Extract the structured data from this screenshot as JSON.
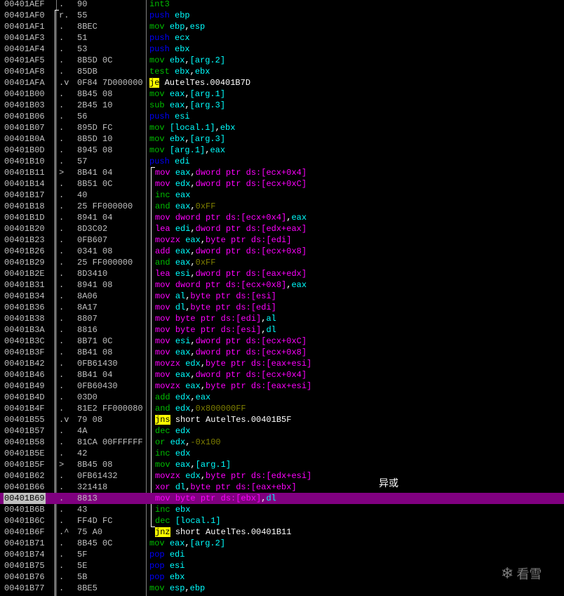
{
  "colors": {
    "background": "#000000",
    "selection": "#800080",
    "address": "#c0c0c0",
    "jump_highlight": "#ffff00",
    "register": "#00ffff",
    "memory": "#ff00ff",
    "constant": "#808000"
  },
  "rows": [
    {
      "addr": "00401AEF",
      "mark": ".",
      "hex": "90",
      "level": 0,
      "op": "int3",
      "opc": "green",
      "args": []
    },
    {
      "addr": "00401AF0",
      "mark": "r.",
      "hex": "55",
      "level": 0,
      "op": "push",
      "opc": "blue",
      "args": [
        {
          "t": "ebp",
          "c": "cyan"
        }
      ]
    },
    {
      "addr": "00401AF1",
      "mark": ".",
      "hex": "8BEC",
      "level": 0,
      "op": "mov",
      "opc": "green",
      "args": [
        {
          "t": "ebp",
          "c": "cyan"
        },
        {
          "t": ",",
          "c": "white"
        },
        {
          "t": "esp",
          "c": "cyan"
        }
      ]
    },
    {
      "addr": "00401AF3",
      "mark": ".",
      "hex": "51",
      "level": 0,
      "op": "push",
      "opc": "blue",
      "args": [
        {
          "t": "ecx",
          "c": "cyan"
        }
      ]
    },
    {
      "addr": "00401AF4",
      "mark": ".",
      "hex": "53",
      "level": 0,
      "op": "push",
      "opc": "blue",
      "args": [
        {
          "t": "ebx",
          "c": "cyan"
        }
      ]
    },
    {
      "addr": "00401AF5",
      "mark": ".",
      "hex": "8B5D 0C",
      "level": 0,
      "op": "mov",
      "opc": "green",
      "args": [
        {
          "t": "ebx",
          "c": "cyan"
        },
        {
          "t": ",",
          "c": "white"
        },
        {
          "t": "[arg.2]",
          "c": "cyan"
        }
      ]
    },
    {
      "addr": "00401AF8",
      "mark": ".",
      "hex": "85DB",
      "level": 0,
      "op": "test",
      "opc": "green",
      "args": [
        {
          "t": "ebx",
          "c": "cyan"
        },
        {
          "t": ",",
          "c": "white"
        },
        {
          "t": "ebx",
          "c": "cyan"
        }
      ]
    },
    {
      "addr": "00401AFA",
      "mark": ".v",
      "hex": "0F84 7D000000",
      "level": 0,
      "op": "je",
      "opc": "jmp",
      "args": [
        {
          "t": "AutelTes.00401B7D",
          "c": "white"
        }
      ]
    },
    {
      "addr": "00401B00",
      "mark": ".",
      "hex": "8B45 08",
      "level": 0,
      "op": "mov",
      "opc": "green",
      "args": [
        {
          "t": "eax",
          "c": "cyan"
        },
        {
          "t": ",",
          "c": "white"
        },
        {
          "t": "[arg.1]",
          "c": "cyan"
        }
      ]
    },
    {
      "addr": "00401B03",
      "mark": ".",
      "hex": "2B45 10",
      "level": 0,
      "op": "sub",
      "opc": "green",
      "args": [
        {
          "t": "eax",
          "c": "cyan"
        },
        {
          "t": ",",
          "c": "white"
        },
        {
          "t": "[arg.3]",
          "c": "cyan"
        }
      ]
    },
    {
      "addr": "00401B06",
      "mark": ".",
      "hex": "56",
      "level": 0,
      "op": "push",
      "opc": "blue",
      "args": [
        {
          "t": "esi",
          "c": "cyan"
        }
      ]
    },
    {
      "addr": "00401B07",
      "mark": ".",
      "hex": "895D FC",
      "level": 0,
      "op": "mov",
      "opc": "green",
      "args": [
        {
          "t": "[local.1]",
          "c": "cyan"
        },
        {
          "t": ",",
          "c": "white"
        },
        {
          "t": "ebx",
          "c": "cyan"
        }
      ]
    },
    {
      "addr": "00401B0A",
      "mark": ".",
      "hex": "8B5D 10",
      "level": 0,
      "op": "mov",
      "opc": "green",
      "args": [
        {
          "t": "ebx",
          "c": "cyan"
        },
        {
          "t": ",",
          "c": "white"
        },
        {
          "t": "[arg.3]",
          "c": "cyan"
        }
      ]
    },
    {
      "addr": "00401B0D",
      "mark": ".",
      "hex": "8945 08",
      "level": 0,
      "op": "mov",
      "opc": "green",
      "args": [
        {
          "t": "[arg.1]",
          "c": "cyan"
        },
        {
          "t": ",",
          "c": "white"
        },
        {
          "t": "eax",
          "c": "cyan"
        }
      ]
    },
    {
      "addr": "00401B10",
      "mark": ".",
      "hex": "57",
      "level": 0,
      "op": "push",
      "opc": "blue",
      "args": [
        {
          "t": "edi",
          "c": "cyan"
        }
      ]
    },
    {
      "addr": "00401B11",
      "mark": ">",
      "hex": "8B41 04",
      "level": 1,
      "op": "mov",
      "opc": "mag",
      "args": [
        {
          "t": "eax",
          "c": "cyan"
        },
        {
          "t": ",",
          "c": "white"
        },
        {
          "t": "dword ptr ds:[ecx+0x4]",
          "c": "mag"
        }
      ]
    },
    {
      "addr": "00401B14",
      "mark": ".",
      "hex": "8B51 0C",
      "level": 1,
      "op": "mov",
      "opc": "mag",
      "args": [
        {
          "t": "edx",
          "c": "cyan"
        },
        {
          "t": ",",
          "c": "white"
        },
        {
          "t": "dword ptr ds:[ecx+0xC]",
          "c": "mag"
        }
      ]
    },
    {
      "addr": "00401B17",
      "mark": ".",
      "hex": "40",
      "level": 1,
      "op": "inc",
      "opc": "green",
      "args": [
        {
          "t": "eax",
          "c": "cyan"
        }
      ]
    },
    {
      "addr": "00401B18",
      "mark": ".",
      "hex": "25 FF000000",
      "level": 1,
      "op": "and",
      "opc": "green",
      "args": [
        {
          "t": "eax",
          "c": "cyan"
        },
        {
          "t": ",",
          "c": "white"
        },
        {
          "t": "0xFF",
          "c": "olive"
        }
      ]
    },
    {
      "addr": "00401B1D",
      "mark": ".",
      "hex": "8941 04",
      "level": 1,
      "op": "mov",
      "opc": "mag",
      "args": [
        {
          "t": "dword ptr ds:[ecx+0x4]",
          "c": "mag"
        },
        {
          "t": ",",
          "c": "white"
        },
        {
          "t": "eax",
          "c": "cyan"
        }
      ]
    },
    {
      "addr": "00401B20",
      "mark": ".",
      "hex": "8D3C02",
      "level": 1,
      "op": "lea",
      "opc": "mag",
      "args": [
        {
          "t": "edi",
          "c": "cyan"
        },
        {
          "t": ",",
          "c": "white"
        },
        {
          "t": "dword ptr ds:[edx+eax]",
          "c": "mag"
        }
      ]
    },
    {
      "addr": "00401B23",
      "mark": ".",
      "hex": "0FB607",
      "level": 1,
      "op": "movzx",
      "opc": "mag",
      "args": [
        {
          "t": "eax",
          "c": "cyan"
        },
        {
          "t": ",",
          "c": "white"
        },
        {
          "t": "byte ptr ds:[edi]",
          "c": "mag"
        }
      ]
    },
    {
      "addr": "00401B26",
      "mark": ".",
      "hex": "0341 08",
      "level": 1,
      "op": "add",
      "opc": "mag",
      "args": [
        {
          "t": "eax",
          "c": "cyan"
        },
        {
          "t": ",",
          "c": "white"
        },
        {
          "t": "dword ptr ds:[ecx+0x8]",
          "c": "mag"
        }
      ]
    },
    {
      "addr": "00401B29",
      "mark": ".",
      "hex": "25 FF000000",
      "level": 1,
      "op": "and",
      "opc": "green",
      "args": [
        {
          "t": "eax",
          "c": "cyan"
        },
        {
          "t": ",",
          "c": "white"
        },
        {
          "t": "0xFF",
          "c": "olive"
        }
      ]
    },
    {
      "addr": "00401B2E",
      "mark": ".",
      "hex": "8D3410",
      "level": 1,
      "op": "lea",
      "opc": "mag",
      "args": [
        {
          "t": "esi",
          "c": "cyan"
        },
        {
          "t": ",",
          "c": "white"
        },
        {
          "t": "dword ptr ds:[eax+edx]",
          "c": "mag"
        }
      ]
    },
    {
      "addr": "00401B31",
      "mark": ".",
      "hex": "8941 08",
      "level": 1,
      "op": "mov",
      "opc": "mag",
      "args": [
        {
          "t": "dword ptr ds:[ecx+0x8]",
          "c": "mag"
        },
        {
          "t": ",",
          "c": "white"
        },
        {
          "t": "eax",
          "c": "cyan"
        }
      ]
    },
    {
      "addr": "00401B34",
      "mark": ".",
      "hex": "8A06",
      "level": 1,
      "op": "mov",
      "opc": "mag",
      "args": [
        {
          "t": "al",
          "c": "cyan"
        },
        {
          "t": ",",
          "c": "white"
        },
        {
          "t": "byte ptr ds:[esi]",
          "c": "mag"
        }
      ]
    },
    {
      "addr": "00401B36",
      "mark": ".",
      "hex": "8A17",
      "level": 1,
      "op": "mov",
      "opc": "mag",
      "args": [
        {
          "t": "dl",
          "c": "cyan"
        },
        {
          "t": ",",
          "c": "white"
        },
        {
          "t": "byte ptr ds:[edi]",
          "c": "mag"
        }
      ]
    },
    {
      "addr": "00401B38",
      "mark": ".",
      "hex": "8807",
      "level": 1,
      "op": "mov",
      "opc": "mag",
      "args": [
        {
          "t": "byte ptr ds:[edi]",
          "c": "mag"
        },
        {
          "t": ",",
          "c": "white"
        },
        {
          "t": "al",
          "c": "cyan"
        }
      ]
    },
    {
      "addr": "00401B3A",
      "mark": ".",
      "hex": "8816",
      "level": 1,
      "op": "mov",
      "opc": "mag",
      "args": [
        {
          "t": "byte ptr ds:[esi]",
          "c": "mag"
        },
        {
          "t": ",",
          "c": "white"
        },
        {
          "t": "dl",
          "c": "cyan"
        }
      ]
    },
    {
      "addr": "00401B3C",
      "mark": ".",
      "hex": "8B71 0C",
      "level": 1,
      "op": "mov",
      "opc": "mag",
      "args": [
        {
          "t": "esi",
          "c": "cyan"
        },
        {
          "t": ",",
          "c": "white"
        },
        {
          "t": "dword ptr ds:[ecx+0xC]",
          "c": "mag"
        }
      ]
    },
    {
      "addr": "00401B3F",
      "mark": ".",
      "hex": "8B41 08",
      "level": 1,
      "op": "mov",
      "opc": "mag",
      "args": [
        {
          "t": "eax",
          "c": "cyan"
        },
        {
          "t": ",",
          "c": "white"
        },
        {
          "t": "dword ptr ds:[ecx+0x8]",
          "c": "mag"
        }
      ]
    },
    {
      "addr": "00401B42",
      "mark": ".",
      "hex": "0FB61430",
      "level": 1,
      "op": "movzx",
      "opc": "mag",
      "args": [
        {
          "t": "edx",
          "c": "cyan"
        },
        {
          "t": ",",
          "c": "white"
        },
        {
          "t": "byte ptr ds:[eax+esi]",
          "c": "mag"
        }
      ]
    },
    {
      "addr": "00401B46",
      "mark": ".",
      "hex": "8B41 04",
      "level": 1,
      "op": "mov",
      "opc": "mag",
      "args": [
        {
          "t": "eax",
          "c": "cyan"
        },
        {
          "t": ",",
          "c": "white"
        },
        {
          "t": "dword ptr ds:[ecx+0x4]",
          "c": "mag"
        }
      ]
    },
    {
      "addr": "00401B49",
      "mark": ".",
      "hex": "0FB60430",
      "level": 1,
      "op": "movzx",
      "opc": "mag",
      "args": [
        {
          "t": "eax",
          "c": "cyan"
        },
        {
          "t": ",",
          "c": "white"
        },
        {
          "t": "byte ptr ds:[eax+esi]",
          "c": "mag"
        }
      ]
    },
    {
      "addr": "00401B4D",
      "mark": ".",
      "hex": "03D0",
      "level": 1,
      "op": "add",
      "opc": "green",
      "args": [
        {
          "t": "edx",
          "c": "cyan"
        },
        {
          "t": ",",
          "c": "white"
        },
        {
          "t": "eax",
          "c": "cyan"
        }
      ]
    },
    {
      "addr": "00401B4F",
      "mark": ".",
      "hex": "81E2 FF000080",
      "level": 1,
      "op": "and",
      "opc": "green",
      "args": [
        {
          "t": "edx",
          "c": "cyan"
        },
        {
          "t": ",",
          "c": "white"
        },
        {
          "t": "0x800000FF",
          "c": "olive"
        }
      ]
    },
    {
      "addr": "00401B55",
      "mark": ".v",
      "hex": "79 08",
      "level": 1,
      "op": "jns",
      "opc": "jmp",
      "args": [
        {
          "t": "short AutelTes.00401B5F",
          "c": "white"
        }
      ]
    },
    {
      "addr": "00401B57",
      "mark": ".",
      "hex": "4A",
      "level": 1,
      "op": "dec",
      "opc": "green",
      "args": [
        {
          "t": "edx",
          "c": "cyan"
        }
      ]
    },
    {
      "addr": "00401B58",
      "mark": ".",
      "hex": "81CA 00FFFFFF",
      "level": 1,
      "op": "or",
      "opc": "green",
      "args": [
        {
          "t": "edx",
          "c": "cyan"
        },
        {
          "t": ",",
          "c": "white"
        },
        {
          "t": "-0x100",
          "c": "olive"
        }
      ]
    },
    {
      "addr": "00401B5E",
      "mark": ".",
      "hex": "42",
      "level": 1,
      "op": "inc",
      "opc": "green",
      "args": [
        {
          "t": "edx",
          "c": "cyan"
        }
      ]
    },
    {
      "addr": "00401B5F",
      "mark": ">",
      "hex": "8B45 08",
      "level": 1,
      "op": "mov",
      "opc": "green",
      "args": [
        {
          "t": "eax",
          "c": "cyan"
        },
        {
          "t": ",",
          "c": "white"
        },
        {
          "t": "[arg.1]",
          "c": "cyan"
        }
      ]
    },
    {
      "addr": "00401B62",
      "mark": ".",
      "hex": "0FB61432",
      "level": 1,
      "op": "movzx",
      "opc": "mag",
      "args": [
        {
          "t": "edx",
          "c": "cyan"
        },
        {
          "t": ",",
          "c": "white"
        },
        {
          "t": "byte ptr ds:[edx+esi]",
          "c": "mag"
        }
      ]
    },
    {
      "addr": "00401B66",
      "mark": ".",
      "hex": "321418",
      "level": 1,
      "op": "xor",
      "opc": "mag",
      "args": [
        {
          "t": "dl",
          "c": "cyan"
        },
        {
          "t": ",",
          "c": "white"
        },
        {
          "t": "byte ptr ds:[eax+ebx]",
          "c": "mag"
        }
      ]
    },
    {
      "addr": "00401B69",
      "mark": ".",
      "hex": "8813",
      "level": 1,
      "op": "mov",
      "opc": "mag",
      "args": [
        {
          "t": "byte ptr ds:[ebx]",
          "c": "mag"
        },
        {
          "t": ",",
          "c": "white"
        },
        {
          "t": "dl",
          "c": "cyan"
        }
      ],
      "selected": true
    },
    {
      "addr": "00401B6B",
      "mark": ".",
      "hex": "43",
      "level": 1,
      "op": "inc",
      "opc": "green",
      "args": [
        {
          "t": "ebx",
          "c": "cyan"
        }
      ]
    },
    {
      "addr": "00401B6C",
      "mark": ".",
      "hex": "FF4D FC",
      "level": 1,
      "op": "dec",
      "opc": "green",
      "args": [
        {
          "t": "[local.1]",
          "c": "cyan"
        }
      ]
    },
    {
      "addr": "00401B6F",
      "mark": ".^",
      "hex": "75 A0",
      "level": 1,
      "op": "jnz",
      "opc": "jmp",
      "args": [
        {
          "t": "short AutelTes.00401B11",
          "c": "white"
        }
      ]
    },
    {
      "addr": "00401B71",
      "mark": ".",
      "hex": "8B45 0C",
      "level": 0,
      "op": "mov",
      "opc": "green",
      "args": [
        {
          "t": "eax",
          "c": "cyan"
        },
        {
          "t": ",",
          "c": "white"
        },
        {
          "t": "[arg.2]",
          "c": "cyan"
        }
      ]
    },
    {
      "addr": "00401B74",
      "mark": ".",
      "hex": "5F",
      "level": 0,
      "op": "pop",
      "opc": "blue",
      "args": [
        {
          "t": "edi",
          "c": "cyan"
        }
      ]
    },
    {
      "addr": "00401B75",
      "mark": ".",
      "hex": "5E",
      "level": 0,
      "op": "pop",
      "opc": "blue",
      "args": [
        {
          "t": "esi",
          "c": "cyan"
        }
      ]
    },
    {
      "addr": "00401B76",
      "mark": ".",
      "hex": "5B",
      "level": 0,
      "op": "pop",
      "opc": "blue",
      "args": [
        {
          "t": "ebx",
          "c": "cyan"
        }
      ]
    },
    {
      "addr": "00401B77",
      "mark": ".",
      "hex": "8BE5",
      "level": 0,
      "op": "mov",
      "opc": "green",
      "args": [
        {
          "t": "esp",
          "c": "cyan"
        },
        {
          "t": ",",
          "c": "white"
        },
        {
          "t": "ebp",
          "c": "cyan"
        }
      ]
    }
  ],
  "comment": "异或",
  "watermark": "看雪",
  "watermark_icon": "snowflake-icon"
}
